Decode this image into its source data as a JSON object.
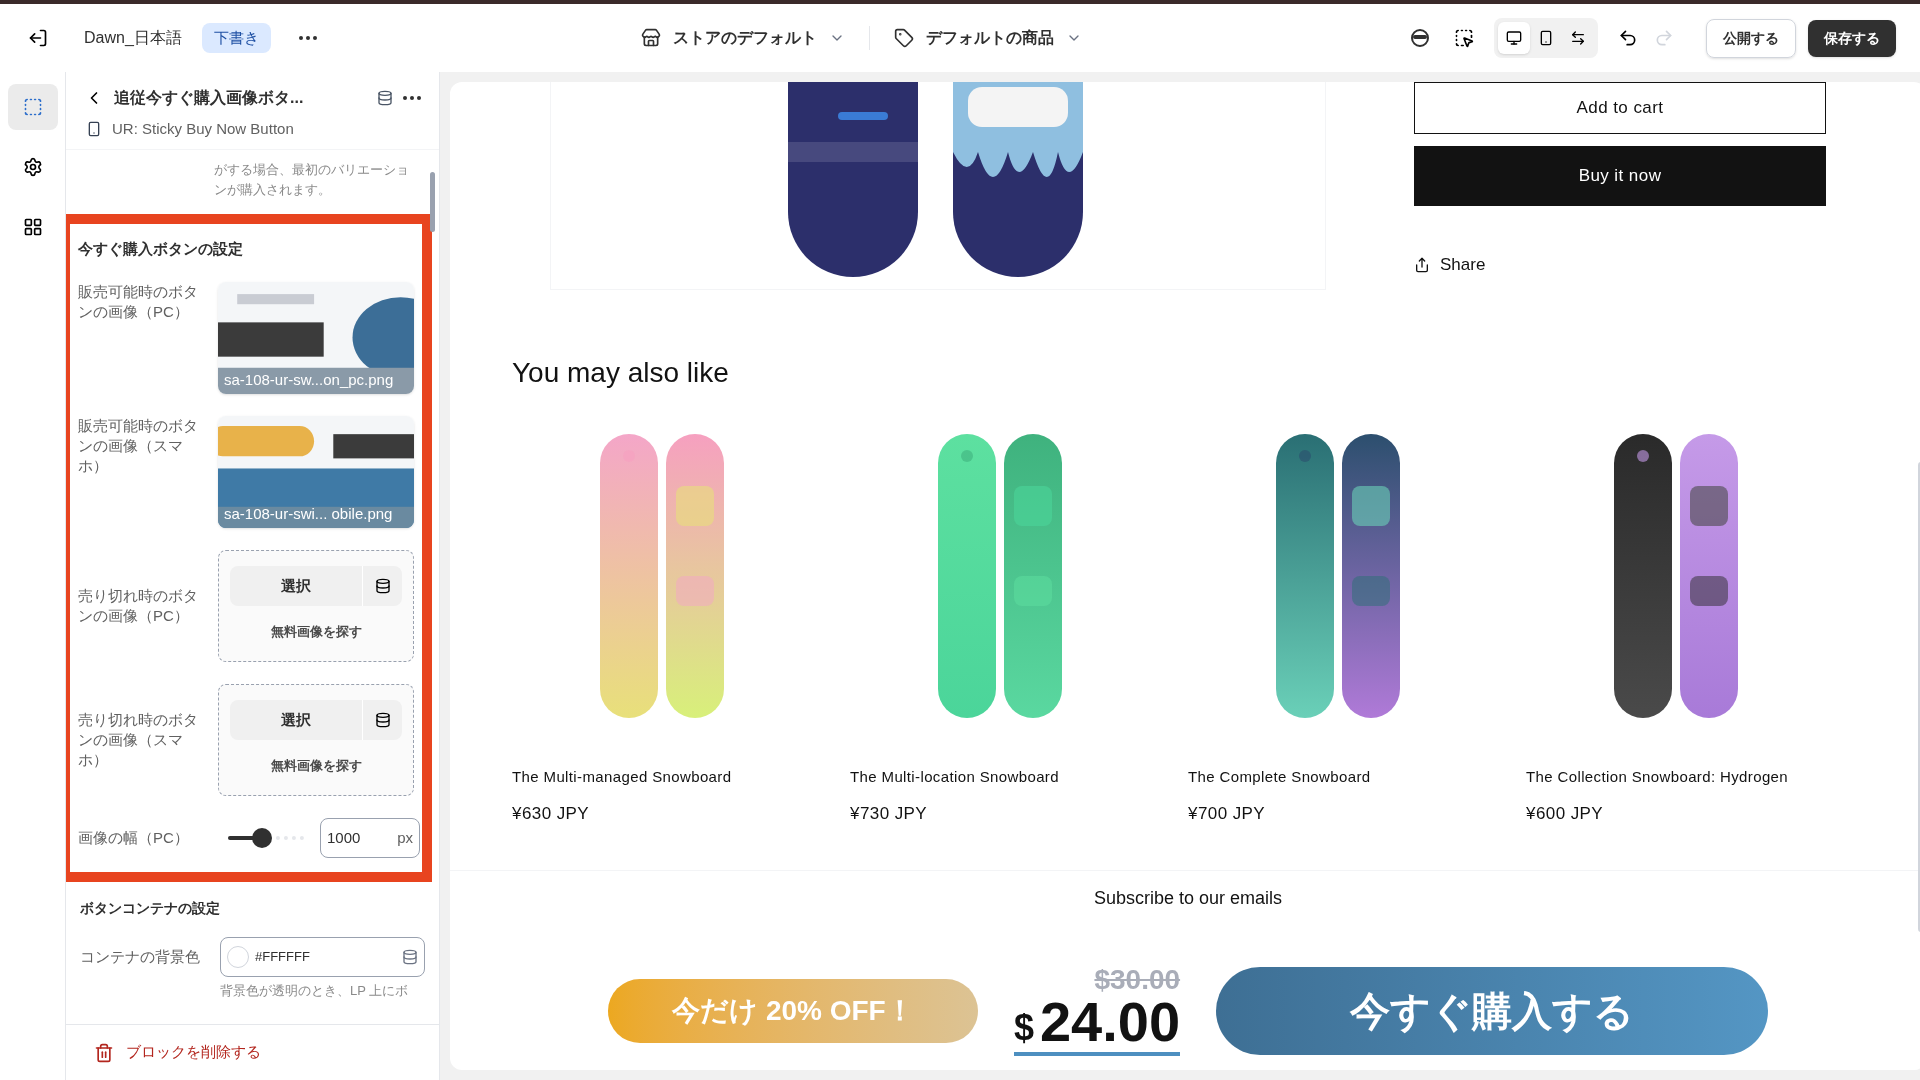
{
  "topbar": {
    "theme_name": "Dawn_日本語",
    "status_badge": "下書き",
    "template_selector": "ストアのデフォルト",
    "product_selector": "デフォルトの商品",
    "view_modes": [
      {
        "kind": "desktop",
        "selected": true
      },
      {
        "kind": "mobile",
        "selected": false
      },
      {
        "kind": "full_width",
        "selected": false
      }
    ],
    "redo": {
      "disabled": true
    },
    "publish_button": "公開する",
    "save_button": "保存する"
  },
  "rail": [
    {
      "kind": "sections",
      "selected": true
    },
    {
      "kind": "settings",
      "selected": false
    },
    {
      "kind": "apps",
      "selected": false
    }
  ],
  "panel": {
    "title": "追従今すぐ購入画像ボタ...",
    "subtitle": "UR: Sticky Buy Now Button",
    "help_text": "がする場合、最初のバリエーションが購入されます。",
    "highlighted_group": {
      "heading": "今すぐ購入ボタンの設定",
      "fields": [
        {
          "label": "販売可能時のボタンの画像（PC）",
          "filename": "sa-108-ur-sw...on_pc.png"
        },
        {
          "label": "販売可能時のボタンの画像（スマホ）",
          "filename": "sa-108-ur-swi... obile.png"
        },
        {
          "kind": "empty_image",
          "label": "売り切れ時のボタンの画像（PC）",
          "select": "選択",
          "explore": "無料画像を探す"
        },
        {
          "kind": "empty_image",
          "label": "売り切れ時のボタンの画像（スマホ）",
          "select": "選択",
          "explore": "無料画像を探す"
        },
        {
          "kind": "range",
          "label": "画像の幅（PC）",
          "level": 0.45,
          "value": "1000",
          "unit": "px"
        }
      ]
    },
    "container_group": {
      "heading": "ボタンコンテナの設定",
      "color_label": "コンテナの背景色",
      "color_value": "#FFFFFF",
      "color": "#ffffff",
      "help_text": "背景色が透明のとき、LP 上にボ"
    },
    "delete_button": "ブロックを削除する"
  },
  "preview": {
    "add_to_cart": "Add to cart",
    "buy_now": "Buy it now",
    "share": "Share",
    "related_heading": "You may also like",
    "products": [
      {
        "title": "The Multi-managed Snowboard",
        "price": "¥630 JPY"
      },
      {
        "title": "The Multi-location Snowboard",
        "price": "¥730 JPY"
      },
      {
        "title": "The Complete Snowboard",
        "price": "¥700 JPY"
      },
      {
        "title": "The Collection Snowboard: Hydrogen",
        "price": "¥600 JPY"
      }
    ],
    "subscribe_heading": "Subscribe to our emails",
    "sticky_bar": {
      "badge": "今だけ 20% OFF！",
      "old_price": "$30.00",
      "currency": "$",
      "price": "24.00",
      "cta": "今すぐ購入する"
    }
  }
}
